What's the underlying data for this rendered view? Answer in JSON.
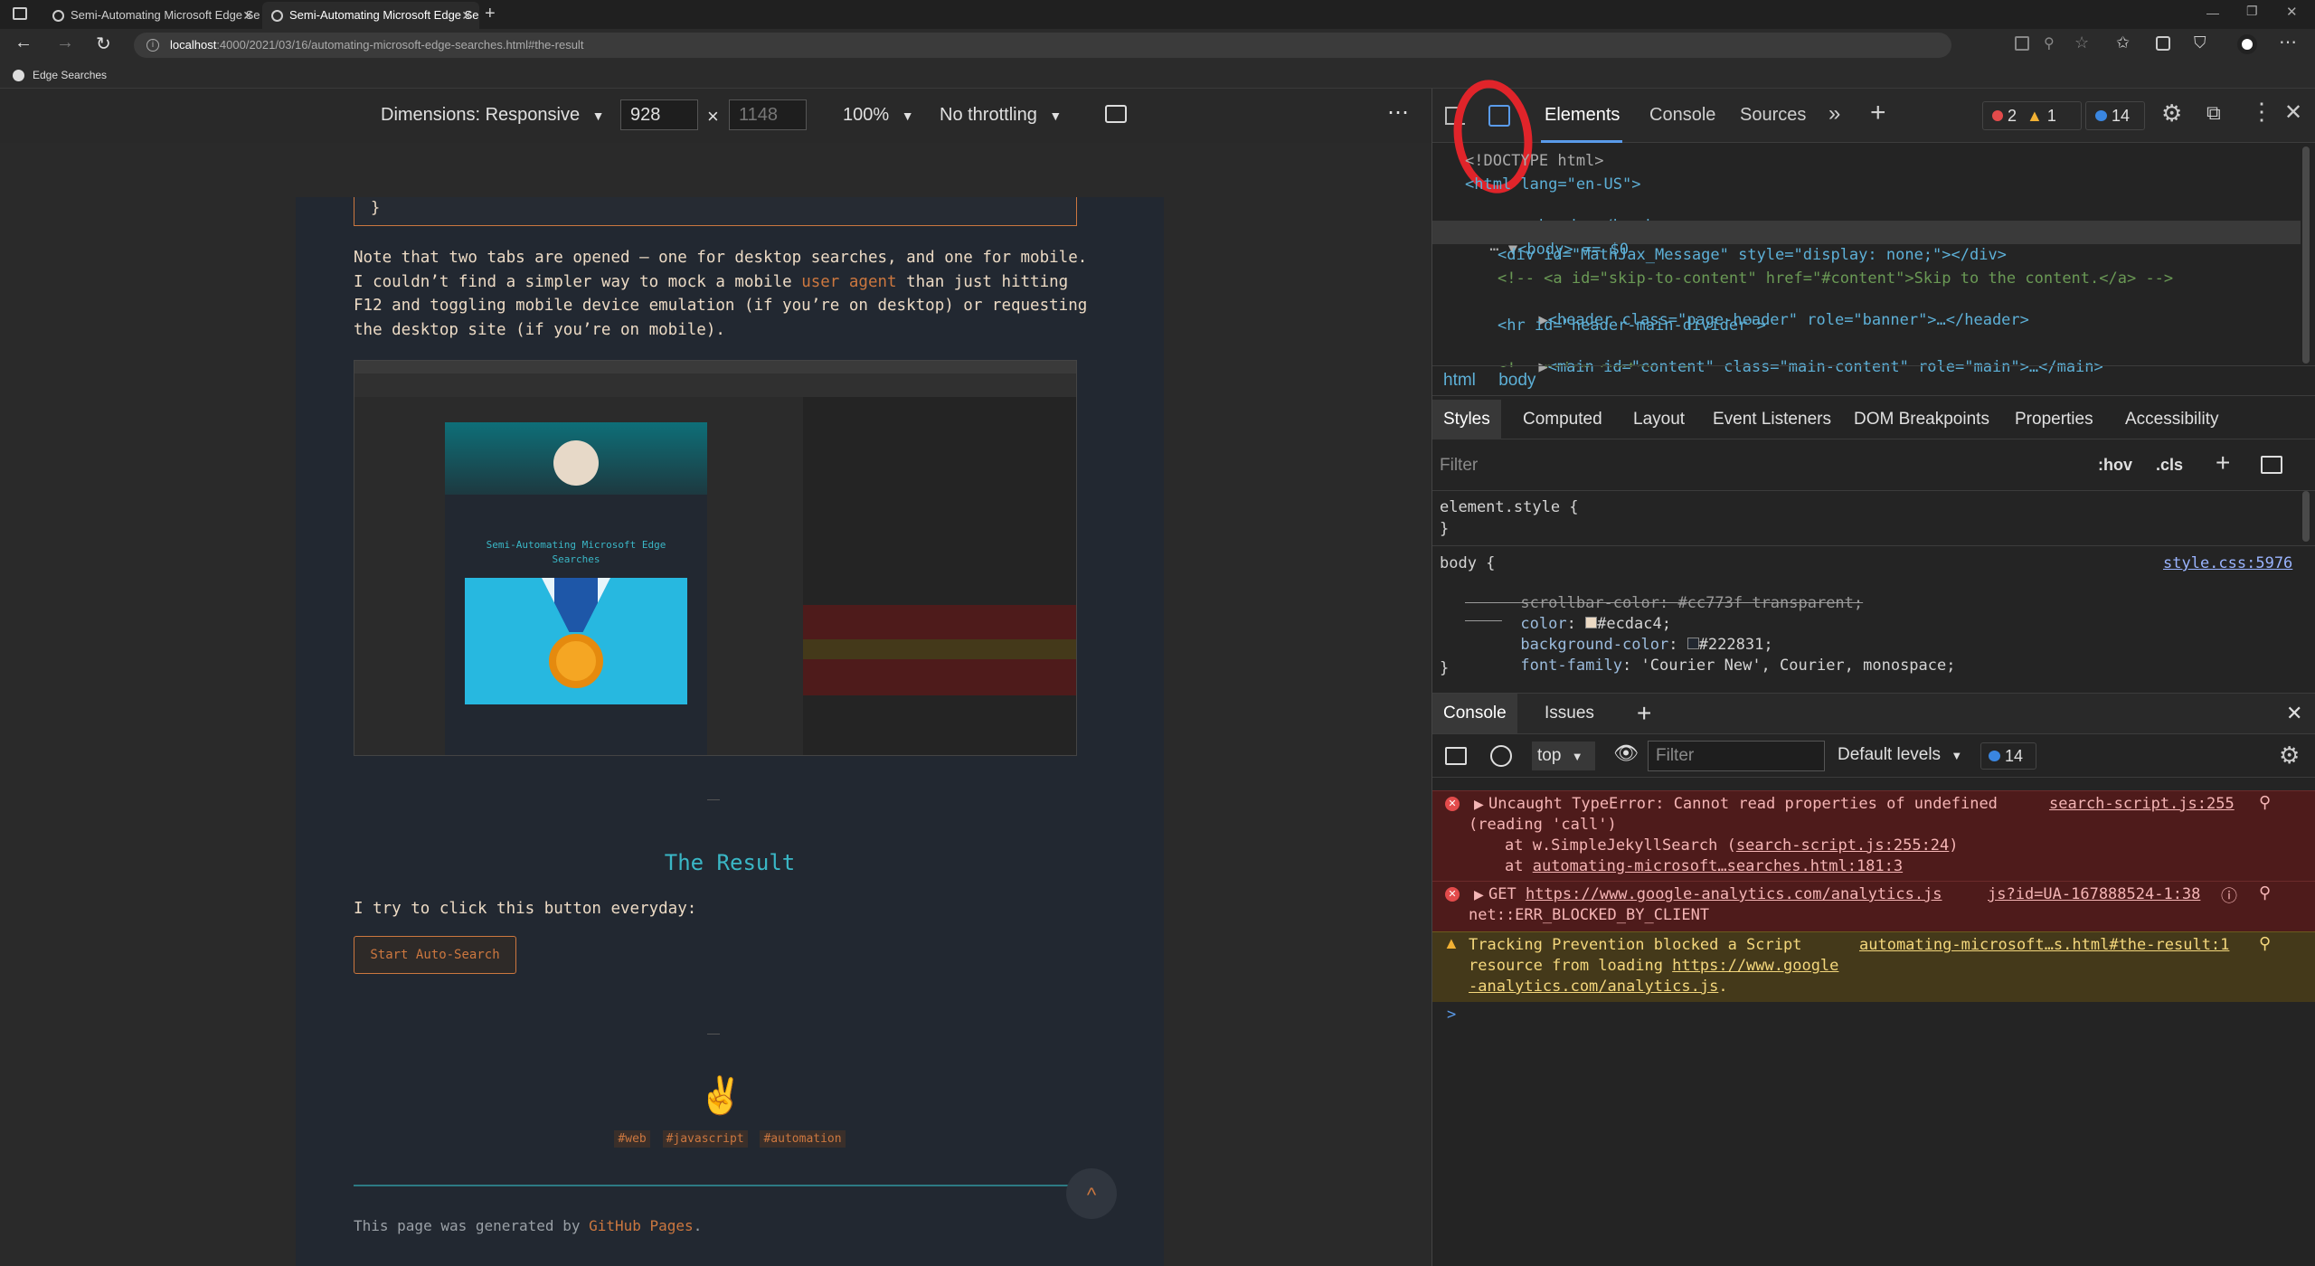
{
  "browser": {
    "tabs": [
      {
        "title": "Semi-Automating Microsoft Edge Se"
      },
      {
        "title": "Semi-Automating Microsoft Edge Se"
      }
    ],
    "new_tab": "+",
    "address_host": "localhost",
    "address_path": ":4000/2021/03/16/automating-microsoft-edge-searches.html#the-result",
    "favorite": "Edge Searches"
  },
  "device_toolbar": {
    "dimensions": "Dimensions: Responsive",
    "width": "928",
    "times": "×",
    "height_placeholder": "1148",
    "zoom": "100%",
    "throttling": "No throttling",
    "more": "⋯"
  },
  "page": {
    "closing_brace": "}",
    "paragraph_pre": "Note that two tabs are opened – one for desktop searches, and one for mobile. I couldn’t find a simpler way to mock a mobile ",
    "paragraph_link": "user agent",
    "paragraph_post": " than just hitting F12 and toggling mobile device emulation (if you’re on desktop) or requesting the desktop site (if you’re on mobile).",
    "heading": "The Result",
    "body_text": "I try to click this button everyday:",
    "button": "Start Auto-Search",
    "tags": [
      "#web",
      "#javascript",
      "#automation"
    ],
    "footer_pre": "This page was generated by ",
    "footer_link": "GitHub Pages",
    "footer_post": ".",
    "thumb_caption": "Semi-Automating Microsoft Edge Searches",
    "back_to_top": "^"
  },
  "devtools": {
    "tabs": [
      "Elements",
      "Console",
      "Sources"
    ],
    "errors": "2",
    "warnings": "1",
    "messages": "14",
    "dom": [
      "<!DOCTYPE html>",
      "<html lang=\"en-US\">",
      "<head>…</head>",
      "<body> == $0",
      "<div id=\"MathJax_Message\" style=\"display: none;\"></div>",
      "<!-- <a id=\"skip-to-content\" href=\"#content\">Skip to the content.</a> -->",
      "<header class=\"page-header\" role=\"banner\">…</header>",
      "<hr id=\"header-main-divider\">",
      "<main id=\"content\" class=\"main-content\" role=\"main\">…</main>",
      "<!-- prism syntax -->"
    ],
    "breadcrumb": [
      "html",
      "body"
    ],
    "style_tabs": [
      "Styles",
      "Computed",
      "Layout",
      "Event Listeners",
      "DOM Breakpoints",
      "Properties",
      "Accessibility"
    ],
    "filter_placeholder": "Filter",
    "hov": ":hov",
    "cls": ".cls",
    "element_style": "element.style {",
    "close_brace": "}",
    "body_selector": "body {",
    "body_source": "style.css:5976",
    "props": [
      {
        "name": "scrollbar-color",
        "value": "#cc773f transparent;",
        "struck": true
      },
      {
        "name": "color",
        "value": "#ecdac4;",
        "swatch": "#ecdac4"
      },
      {
        "name": "background-color",
        "value": "#222831;",
        "swatch": "#222831"
      },
      {
        "name": "font-family",
        "value": "'Courier New', Courier, monospace;"
      }
    ],
    "drawer_tabs": [
      "Console",
      "Issues"
    ],
    "context": "top",
    "console_filter": "Filter",
    "levels": "Default levels",
    "console_count": "14",
    "console": {
      "e1_line1": "Uncaught TypeError: Cannot read properties of undefined",
      "e1_line2": "(reading 'call')",
      "e1_at1_pre": "at w.SimpleJekyllSearch (",
      "e1_at1_link": "search-script.js:255:24",
      "e1_at1_post": ")",
      "e1_at2_pre": "at ",
      "e1_at2_link": "automating-microsoft…searches.html:181:3",
      "e1_src": "search-script.js:255",
      "e2_pre": "GET ",
      "e2_link": "https://www.google-analytics.com/analytics.js",
      "e2_line2": "net::ERR_BLOCKED_BY_CLIENT",
      "e2_src": "js?id=UA-167888524-1:38",
      "w_line1": "Tracking Prevention blocked a Script",
      "w_line2_pre": "resource from loading ",
      "w_line2_link": "https://www.google",
      "w_line3_link": "-analytics.com/analytics.js",
      "w_line3_post": ".",
      "w_src": "automating-microsoft…s.html#the-result:1",
      "prompt": ">"
    }
  },
  "colors": {
    "page_bg": "#222831",
    "accent": "#cc773f",
    "teal": "#3ab7c6",
    "annotation": "#e0242a"
  }
}
